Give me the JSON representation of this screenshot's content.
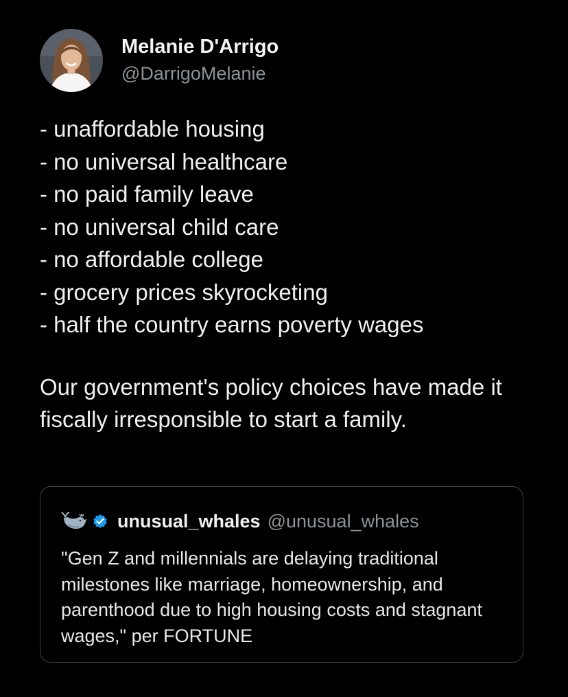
{
  "tweet": {
    "author": {
      "name": "Melanie D'Arrigo",
      "handle": "@DarrigoMelanie",
      "avatar_icon": "profile-photo"
    },
    "list_items": [
      "- unaffordable housing",
      "- no universal healthcare",
      "- no paid family leave",
      "- no universal child care",
      "- no affordable college",
      "- grocery prices skyrocketing",
      "- half the country earns poverty wages"
    ],
    "paragraph": "Our government's policy choices have made it fiscally irresponsible to start a family."
  },
  "quoted_tweet": {
    "name": "unusual_whales",
    "handle": "@unusual_whales",
    "avatar_icon": "whale-icon",
    "verified_icon": "verified-badge-icon",
    "text": "\"Gen Z and millennials are delaying traditional milestones like marriage, homeownership, and parenthood due to high housing costs and stagnant wages,\" per FORTUNE"
  },
  "colors": {
    "background": "#000000",
    "text": "#f0f0f0",
    "secondary_text": "#8b9299",
    "border": "#3e4246",
    "verified": "#1d9bf0"
  }
}
